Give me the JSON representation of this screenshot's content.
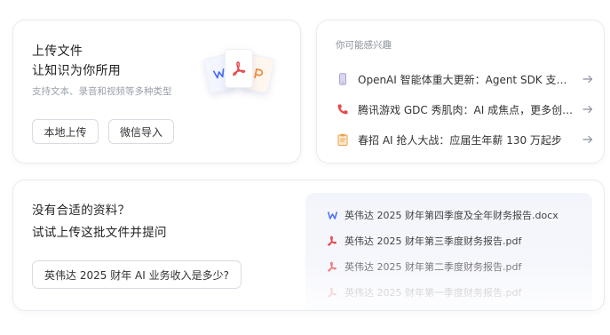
{
  "upload": {
    "title_line1": "上传文件",
    "title_line2": "让知识为你所用",
    "subtitle": "支持文本、录音和视频等多种类型",
    "local_button": "本地上传",
    "wechat_button": "微信导入",
    "illustration_icons": [
      "word-icon",
      "pdf-icon",
      "ppt-icon"
    ]
  },
  "interest": {
    "title": "你可能感兴趣",
    "items": [
      {
        "text": "OpenAI 智能体重大更新：Agent SDK 支持多语言开发",
        "icon": "phone-device-icon",
        "color": "#a8a3cf"
      },
      {
        "text": "腾讯游戏 GDC 秀肌肉：AI 成焦点，更多创新技术亮相",
        "icon": "telephone-icon",
        "color": "#e5484d"
      },
      {
        "text": "春招 AI 抢人大战：应届生年薪 130 万起步",
        "icon": "clipboard-icon",
        "color": "#e9a14a"
      }
    ]
  },
  "suggest": {
    "title_line1": "没有合适的资料？",
    "title_line2": "试试上传这批文件并提问",
    "question": "英伟达 2025 财年 AI 业务收入是多少?",
    "files": [
      {
        "name": "英伟达 2025 财年第四季度及全年财务报告.docx",
        "type": "word"
      },
      {
        "name": "英伟达 2025 财年第三季度财务报告.pdf",
        "type": "pdf"
      },
      {
        "name": "英伟达 2025 财年第二季度财务报告.pdf",
        "type": "pdf"
      },
      {
        "name": "英伟达 2025 财年第一季度财务报告.pdf",
        "type": "pdf"
      }
    ]
  },
  "colors": {
    "word": "#4a6cf7",
    "pdf": "#e5484d",
    "ppt": "#f08c3a"
  }
}
